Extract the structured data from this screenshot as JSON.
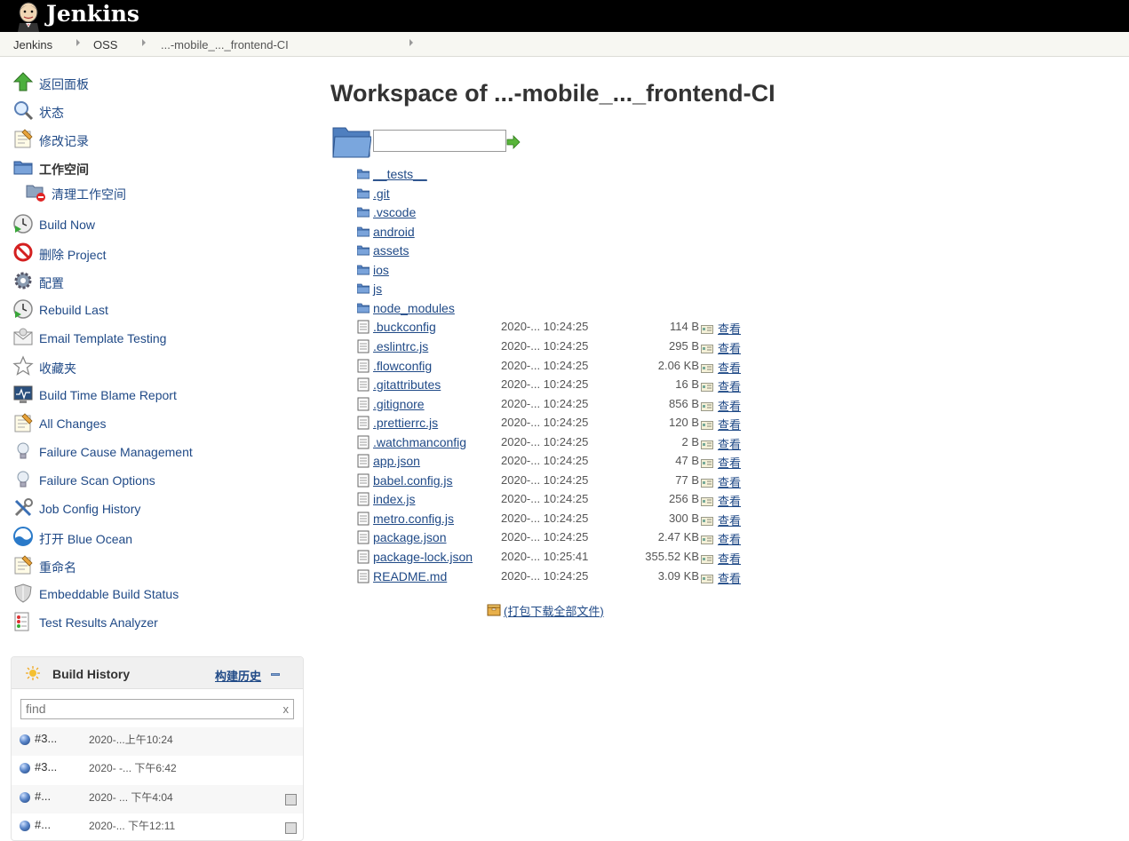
{
  "header": {
    "brand": "Jenkins",
    "logo_icon": "jenkins-butler-icon"
  },
  "breadcrumb": [
    "Jenkins",
    "OSS",
    "...-mobile_..._frontend-CI"
  ],
  "sidebar": {
    "items": [
      {
        "label": "返回面板",
        "icon": "up-arrow-icon"
      },
      {
        "label": "状态",
        "icon": "magnifier-icon"
      },
      {
        "label": "修改记录",
        "icon": "notepad-icon"
      },
      {
        "label": "工作空间",
        "icon": "folder-icon",
        "active": true
      },
      {
        "label": "清理工作空间",
        "icon": "folder-delete-icon"
      },
      {
        "label": "Build Now",
        "icon": "clock-play-icon"
      },
      {
        "label": "删除 Project",
        "icon": "no-entry-icon"
      },
      {
        "label": "配置",
        "icon": "gear-icon"
      },
      {
        "label": "Rebuild Last",
        "icon": "clock-play-icon"
      },
      {
        "label": "Email Template Testing",
        "icon": "envelope-icon"
      },
      {
        "label": "收藏夹",
        "icon": "star-icon"
      },
      {
        "label": "Build Time Blame Report",
        "icon": "monitor-icon"
      },
      {
        "label": "All Changes",
        "icon": "notepad-icon"
      },
      {
        "label": "Failure Cause Management",
        "icon": "lightbulb-icon"
      },
      {
        "label": "Failure Scan Options",
        "icon": "lightbulb-icon"
      },
      {
        "label": "Job Config History",
        "icon": "tools-icon"
      },
      {
        "label": "打开 Blue Ocean",
        "icon": "blue-ocean-icon"
      },
      {
        "label": "重命名",
        "icon": "notepad-icon"
      },
      {
        "label": "Embeddable Build Status",
        "icon": "shield-icon"
      },
      {
        "label": "Test Results Analyzer",
        "icon": "test-report-icon"
      }
    ]
  },
  "build_history": {
    "title": "Build History",
    "trend_link": "构建历史",
    "find_placeholder": "find",
    "clear": "x",
    "builds": [
      {
        "num": "#3...",
        "date": "2020-...上午10:24",
        "console": false
      },
      {
        "num": "#3...",
        "date": "2020- -... 下午6:42",
        "console": false
      },
      {
        "num": "#...",
        "date": "2020- ... 下午4:04",
        "console": true
      },
      {
        "num": "#...",
        "date": "2020-... 下午12:11",
        "console": true
      }
    ]
  },
  "main": {
    "title": "Workspace of ...-mobile_..._frontend-CI",
    "folders": [
      "__tests__",
      ".git",
      ".vscode",
      "android",
      "assets",
      "ios",
      "js",
      "node_modules"
    ],
    "files": [
      {
        "name": ".buckconfig",
        "date": "2020-... 10:24:25",
        "size": "114 B",
        "view": "查看"
      },
      {
        "name": ".eslintrc.js",
        "date": "2020-... 10:24:25",
        "size": "295 B",
        "view": "查看"
      },
      {
        "name": ".flowconfig",
        "date": "2020-... 10:24:25",
        "size": "2.06 KB",
        "view": "查看"
      },
      {
        "name": ".gitattributes",
        "date": "2020-... 10:24:25",
        "size": "16 B",
        "view": "查看"
      },
      {
        "name": ".gitignore",
        "date": "2020-... 10:24:25",
        "size": "856 B",
        "view": "查看"
      },
      {
        "name": ".prettierrc.js",
        "date": "2020-... 10:24:25",
        "size": "120 B",
        "view": "查看"
      },
      {
        "name": ".watchmanconfig",
        "date": "2020-... 10:24:25",
        "size": "2 B",
        "view": "查看"
      },
      {
        "name": "app.json",
        "date": "2020-... 10:24:25",
        "size": "47 B",
        "view": "查看"
      },
      {
        "name": "babel.config.js",
        "date": "2020-... 10:24:25",
        "size": "77 B",
        "view": "查看"
      },
      {
        "name": "index.js",
        "date": "2020-... 10:24:25",
        "size": "256 B",
        "view": "查看"
      },
      {
        "name": "metro.config.js",
        "date": "2020-... 10:24:25",
        "size": "300 B",
        "view": "查看"
      },
      {
        "name": "package.json",
        "date": "2020-... 10:24:25",
        "size": "2.47 KB",
        "view": "查看"
      },
      {
        "name": "package-lock.json",
        "date": "2020-... 10:25:41",
        "size": "355.52 KB",
        "view": "查看"
      },
      {
        "name": "README.md",
        "date": "2020-... 10:24:25",
        "size": "3.09 KB",
        "view": "查看"
      }
    ],
    "download_all": "(打包下载全部文件)"
  }
}
